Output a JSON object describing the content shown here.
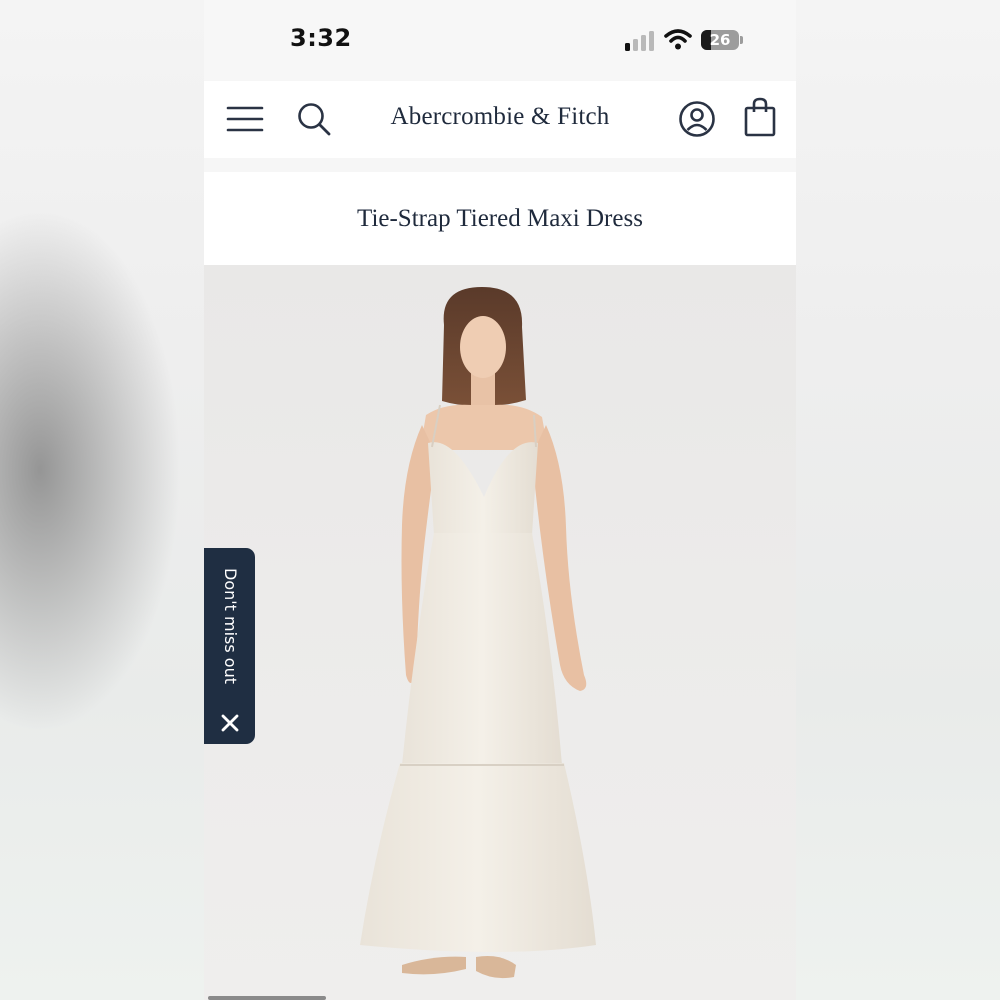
{
  "status_bar": {
    "time": "3:32",
    "battery_level": "26",
    "battery_fraction": 0.26,
    "signal_bars_active": 1,
    "signal_bars_total": 4
  },
  "header": {
    "brand": "Abercrombie & Fitch",
    "icons": [
      "menu-icon",
      "search-icon",
      "account-icon",
      "shopping-bag-icon"
    ]
  },
  "product": {
    "title": "Tie-Strap Tiered Maxi Dress"
  },
  "promo_tab": {
    "label": "Don't miss out",
    "close_icon": "close-icon"
  },
  "colors": {
    "brand_navy": "#1f2a3c",
    "promo_background": "#1f2e42",
    "header_background": "#ffffff",
    "page_background": "#f6f6f6"
  }
}
